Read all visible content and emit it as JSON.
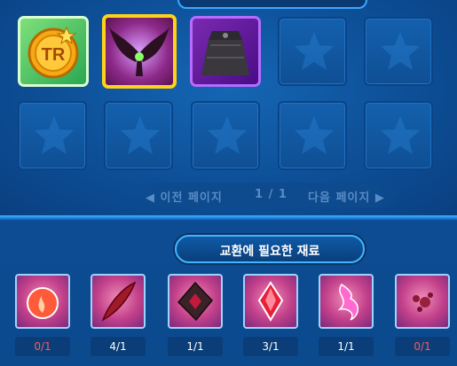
{
  "inventory": {
    "items": [
      {
        "name": "tr-coin-icon"
      },
      {
        "name": "dark-wings-icon"
      },
      {
        "name": "dark-skirt-icon"
      }
    ]
  },
  "pager": {
    "prev_label": "◀ 이전 페이지",
    "page_indicator": "1 / 1",
    "next_label": "다음 페이지 ▶"
  },
  "materials": {
    "title": "교환에 필요한 재료",
    "items": [
      {
        "name": "flame-stone-icon",
        "count": "0/1",
        "sufficient": false
      },
      {
        "name": "feather-quill-icon",
        "count": "4/1",
        "sufficient": true
      },
      {
        "name": "dark-gem-shard-icon",
        "count": "1/1",
        "sufficient": true
      },
      {
        "name": "red-crystal-icon",
        "count": "3/1",
        "sufficient": true
      },
      {
        "name": "pink-flame-essence-icon",
        "count": "1/1",
        "sufficient": true
      },
      {
        "name": "crimson-dust-icon",
        "count": "0/1",
        "sufficient": false
      }
    ]
  },
  "colors": {
    "insufficient": "#ff5a5a",
    "sufficient": "#ffffff",
    "selected_border": "#ffd21a",
    "accent_blue": "#41b6ff"
  }
}
